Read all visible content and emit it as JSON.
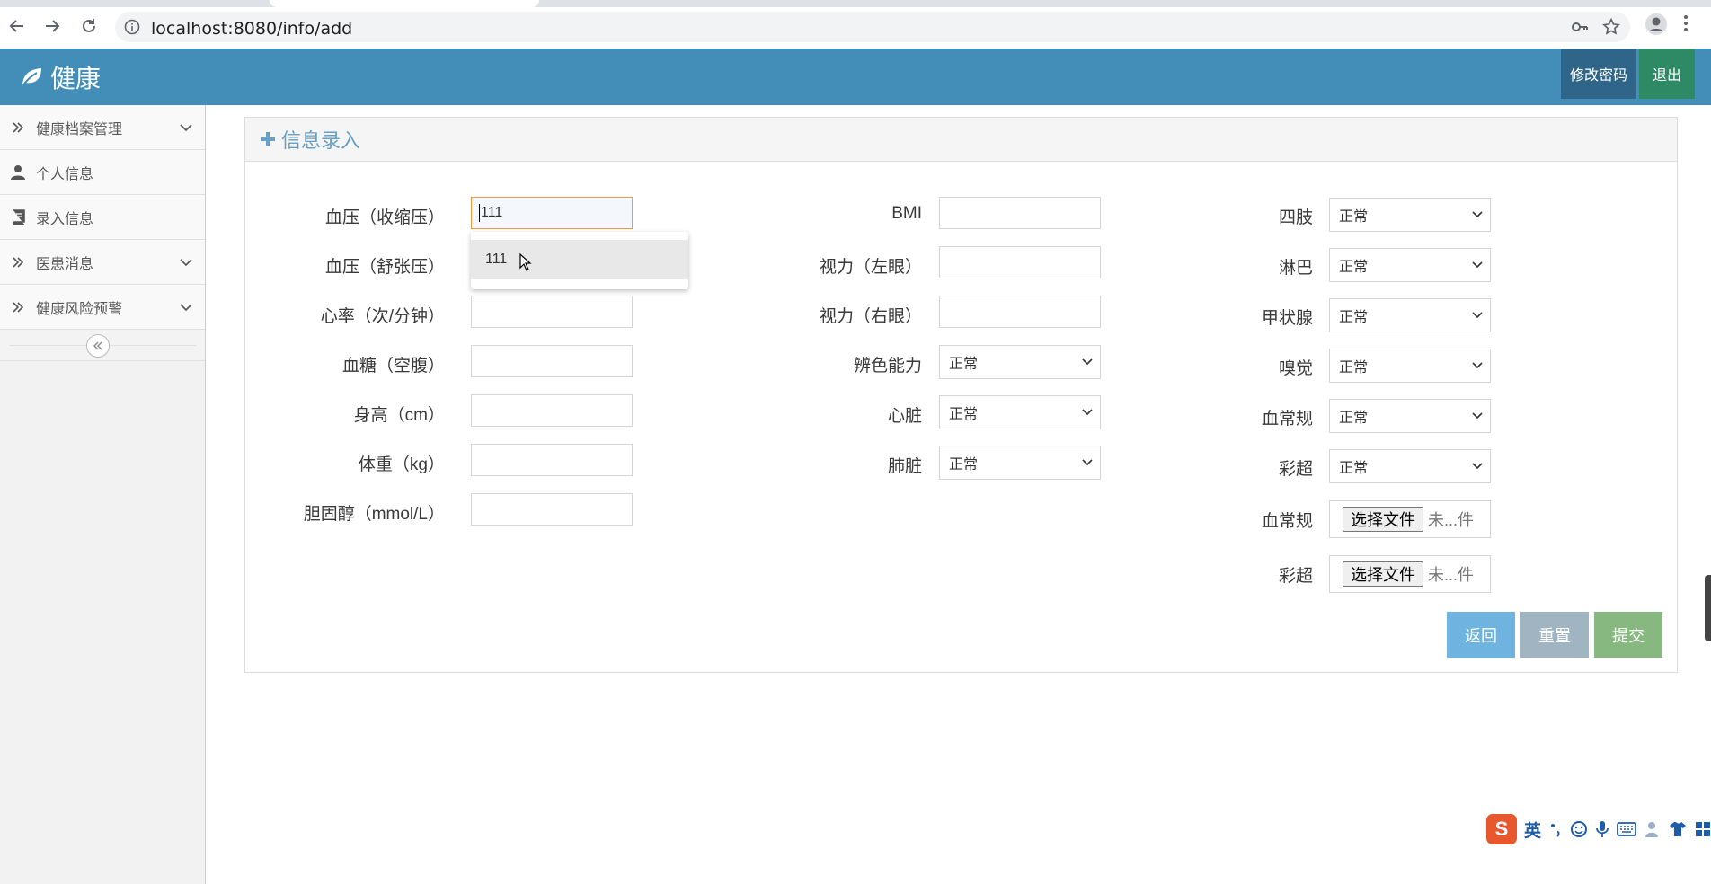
{
  "browser": {
    "url": "localhost:8080/info/add"
  },
  "header": {
    "brand": "健康",
    "change_password": "修改密码",
    "logout": "退出"
  },
  "sidebar": {
    "items": [
      {
        "label": "健康档案管理",
        "icon": "double-chevron-right-icon",
        "has_submenu": true
      },
      {
        "label": "个人信息",
        "icon": "user-icon",
        "has_submenu": false
      },
      {
        "label": "录入信息",
        "icon": "book-icon",
        "has_submenu": false
      },
      {
        "label": "医患消息",
        "icon": "double-chevron-right-icon",
        "has_submenu": true
      },
      {
        "label": "健康风险预警",
        "icon": "double-chevron-right-icon",
        "has_submenu": true
      }
    ]
  },
  "panel": {
    "title": "信息录入"
  },
  "form": {
    "col1": [
      {
        "label": "血压（收缩压）",
        "value": "111"
      },
      {
        "label": "血压（舒张压）",
        "value": ""
      },
      {
        "label": "心率（次/分钟）",
        "value": ""
      },
      {
        "label": "血糖（空腹）",
        "value": ""
      },
      {
        "label": "身高（cm）",
        "value": ""
      },
      {
        "label": "体重（kg）",
        "value": ""
      },
      {
        "label": "胆固醇（mmol/L）",
        "value": ""
      }
    ],
    "col2": [
      {
        "label": "BMI",
        "value": ""
      },
      {
        "label": "视力（左眼）",
        "value": ""
      },
      {
        "label": "视力（右眼）",
        "value": ""
      },
      {
        "label": "辨色能力",
        "value": "正常"
      },
      {
        "label": "心脏",
        "value": "正常"
      },
      {
        "label": "肺脏",
        "value": "正常"
      }
    ],
    "col3": [
      {
        "label": "四肢",
        "value": "正常"
      },
      {
        "label": "淋巴",
        "value": "正常"
      },
      {
        "label": "甲状腺",
        "value": "正常"
      },
      {
        "label": "嗅觉",
        "value": "正常"
      },
      {
        "label": "血常规",
        "value": "正常"
      },
      {
        "label": "彩超",
        "value": "正常"
      }
    ],
    "files": [
      {
        "label": "血常规",
        "button": "选择文件",
        "status": "未...件"
      },
      {
        "label": "彩超",
        "button": "选择文件",
        "status": "未...件"
      }
    ],
    "autocomplete_option": "111"
  },
  "actions": {
    "back": "返回",
    "reset": "重置",
    "submit": "提交"
  },
  "ime": {
    "logo": "S",
    "lang": "英"
  },
  "colors": {
    "header": "#438eb9",
    "change_password_bg": "#2e6589",
    "logout_bg": "#2e8965",
    "panel_title": "#669fc7",
    "back_btn": "#6fb3e0",
    "reset_btn": "#a0b4c2",
    "submit_btn": "#87b87f"
  }
}
